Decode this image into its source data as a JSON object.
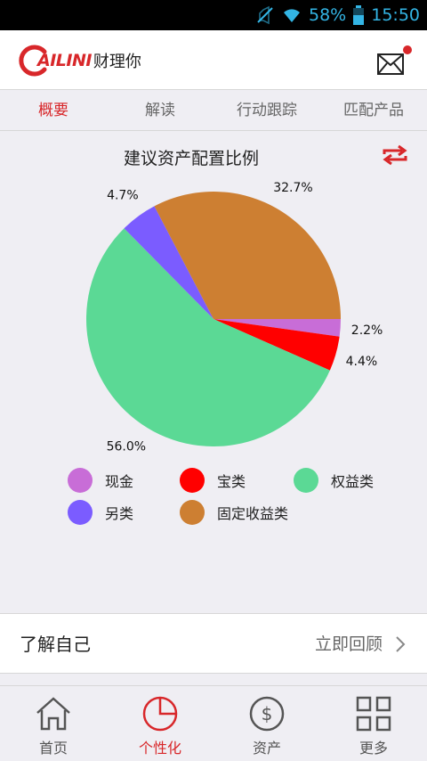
{
  "status_bar": {
    "battery": "58%",
    "time": "15:50",
    "icons": [
      "mute-icon",
      "wifi-icon",
      "battery-icon"
    ]
  },
  "header": {
    "logo_text": "AILINI",
    "logo_cn": "财理你",
    "mail_icon": "mail-icon",
    "has_notification": true
  },
  "tabs": [
    {
      "label": "概要",
      "active": true
    },
    {
      "label": "解读",
      "active": false
    },
    {
      "label": "行动跟踪",
      "active": false
    },
    {
      "label": "匹配产品",
      "active": false
    }
  ],
  "chart_data": {
    "type": "pie",
    "title": "建议资产配置比例",
    "slices": [
      {
        "name": "现金",
        "value": 2.2,
        "label": "2.2%",
        "color": "#c86dd7"
      },
      {
        "name": "宝类",
        "value": 4.4,
        "label": "4.4%",
        "color": "#ff0000"
      },
      {
        "name": "权益类",
        "value": 56.0,
        "label": "56.0%",
        "color": "#5bd995"
      },
      {
        "name": "另类",
        "value": 4.7,
        "label": "4.7%",
        "color": "#7b5cff"
      },
      {
        "name": "固定收益类",
        "value": 32.7,
        "label": "32.7%",
        "color": "#cd7f32"
      }
    ]
  },
  "legend": [
    {
      "label": "现金",
      "color": "#c86dd7"
    },
    {
      "label": "宝类",
      "color": "#ff0000"
    },
    {
      "label": "权益类",
      "color": "#5bd995"
    },
    {
      "label": "另类",
      "color": "#7b5cff"
    },
    {
      "label": "固定收益类",
      "color": "#cd7f32"
    }
  ],
  "know_yourself": {
    "label": "了解自己",
    "action": "立即回顾"
  },
  "bottom_nav": [
    {
      "label": "首页",
      "icon": "home-icon",
      "active": false
    },
    {
      "label": "个性化",
      "icon": "pie-chart-icon",
      "active": true
    },
    {
      "label": "资产",
      "icon": "dollar-icon",
      "active": false
    },
    {
      "label": "更多",
      "icon": "grid-icon",
      "active": false
    }
  ],
  "colors": {
    "accent": "#d8272a",
    "status": "#33b5e5"
  }
}
